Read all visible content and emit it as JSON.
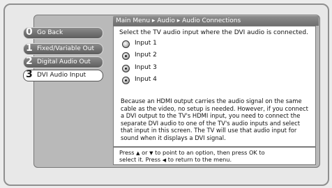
{
  "menu": {
    "items": [
      {
        "num": "0",
        "label": "Go Back"
      },
      {
        "num": "1",
        "label": "Fixed/Variable Out"
      },
      {
        "num": "2",
        "label": "Digital Audio Out"
      },
      {
        "num": "3",
        "label": "DVI Audio Input"
      }
    ],
    "selected_index": 3
  },
  "breadcrumb": {
    "text": "Main Menu ▸ Audio ▸ Audio Connections"
  },
  "content": {
    "prompt": "Select the TV audio input where the DVI audio is connected.",
    "options": [
      "Input 1",
      "Input 2",
      "Input 3",
      "Input 4"
    ],
    "note": "Because an HDMI output carries the audio signal on the same cable as the video, no setup is needed. However, if you connect a DVI output to the TV's HDMI input, you need to connect the separate DVI audio to one of the TV's audio inputs and select that input in this screen. The TV will use that audio input for sound when it displays a DVI signal."
  },
  "help": {
    "line1_a": "Press",
    "up_arrow": "▲",
    "line1_b": "or",
    "down_arrow": "▼",
    "line1_c": "to point to an option, then press OK to",
    "line2_a": "select it. Press",
    "left_arrow": "◀",
    "line2_b": "to return to the menu."
  }
}
